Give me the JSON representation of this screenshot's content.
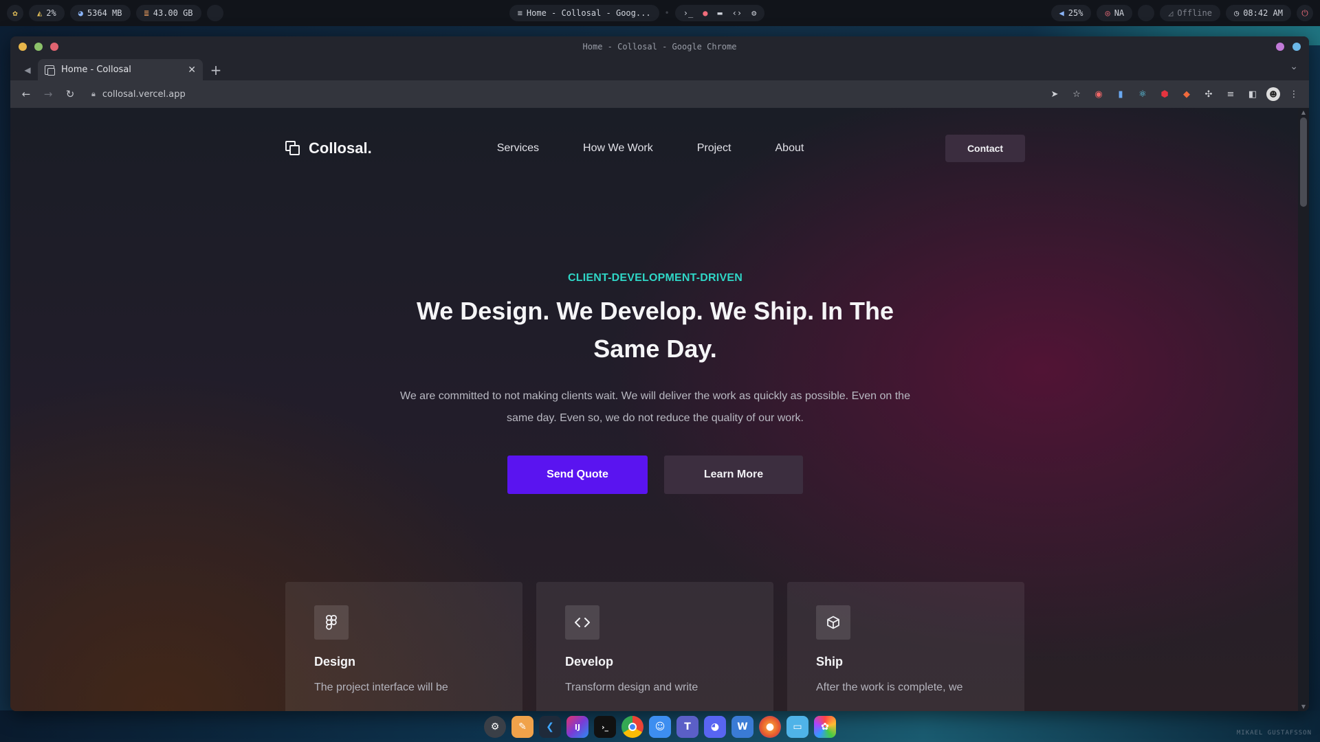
{
  "system_bar": {
    "cpu": "2%",
    "memory": "5364 MB",
    "disk": "43.00 GB",
    "window_title": "Home - Collosal - Goog...",
    "volume": "25%",
    "vpn": "NA",
    "network": "Offline",
    "clock": "08:42 AM"
  },
  "browser": {
    "window_title": "Home - Collosal - Google Chrome",
    "tab_title": "Home - Collosal",
    "url": "collosal.vercel.app"
  },
  "site": {
    "brand": "Collosal.",
    "nav": [
      "Services",
      "How We Work",
      "Project",
      "About"
    ],
    "contact_label": "Contact",
    "eyebrow": "CLIENT-DEVELOPMENT-DRIVEN",
    "headline": "We Design. We Develop. We Ship. In The Same Day.",
    "subtext": "We are committed to not making clients wait. We will deliver the work as quickly as possible. Even on the same day. Even so, we do not reduce the quality of our work.",
    "primary_cta": "Send Quote",
    "secondary_cta": "Learn More",
    "cards": [
      {
        "icon": "figma-icon",
        "title": "Design",
        "text": "The project interface will be"
      },
      {
        "icon": "code-icon",
        "title": "Develop",
        "text": "Transform design and write"
      },
      {
        "icon": "box-icon",
        "title": "Ship",
        "text": "After the work is complete, we"
      }
    ]
  },
  "colors": {
    "accent_teal": "#2fd6c6",
    "primary_purple": "#5a14f0",
    "secondary_plum": "#3c2e3f"
  },
  "watermark": "MIKAEL GUSTAFSSON"
}
